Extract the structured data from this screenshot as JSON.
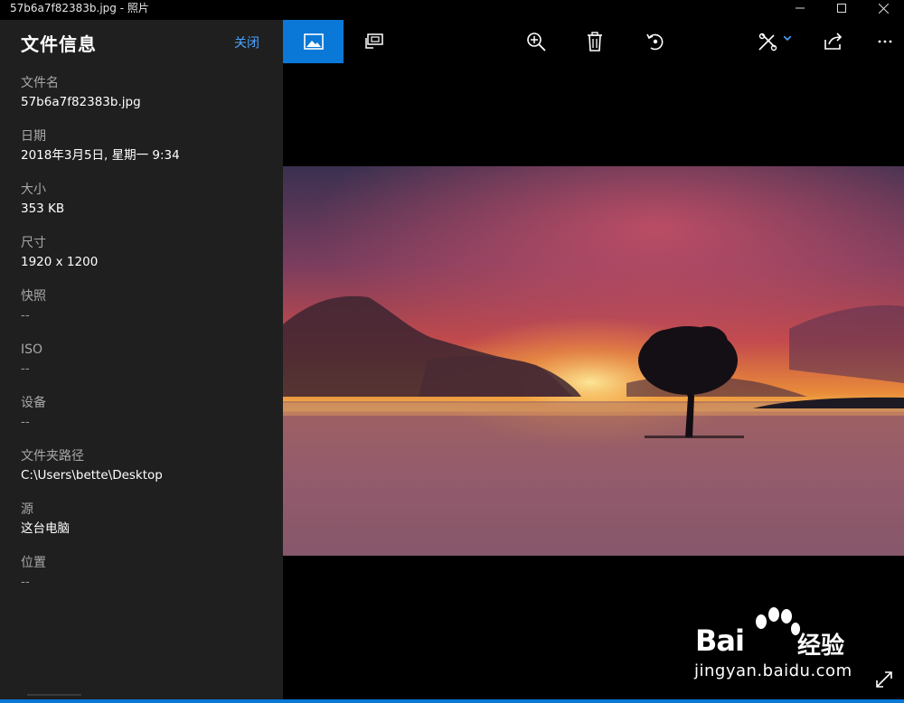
{
  "window": {
    "title": "57b6a7f82383b.jpg - 照片",
    "minimize_icon": "minimize-icon",
    "maximize_icon": "maximize-icon",
    "close_icon": "close-icon"
  },
  "sidebar": {
    "title": "文件信息",
    "close_label": "关闭",
    "fields": [
      {
        "label": "文件名",
        "value": "57b6a7f82383b.jpg"
      },
      {
        "label": "日期",
        "value": "2018年3月5日, 星期一 9:34"
      },
      {
        "label": "大小",
        "value": "353 KB"
      },
      {
        "label": "尺寸",
        "value": "1920 x 1200"
      },
      {
        "label": "快照",
        "value": "--"
      },
      {
        "label": "ISO",
        "value": "--"
      },
      {
        "label": "设备",
        "value": "--"
      },
      {
        "label": "文件夹路径",
        "value": "C:\\Users\\bette\\Desktop"
      },
      {
        "label": "源",
        "value": "这台电脑"
      },
      {
        "label": "位置",
        "value": "--"
      }
    ]
  },
  "toolbar": {
    "accent": "#0a78d7",
    "buttons": [
      "image-icon",
      "slideshow-icon",
      "zoom-in-icon",
      "delete-icon",
      "rotate-icon",
      "edit-create-icon",
      "share-icon",
      "more-icon"
    ]
  },
  "watermark": {
    "brand": "Bai",
    "brand_cn": "经验",
    "url": "jingyan.baidu.com"
  }
}
